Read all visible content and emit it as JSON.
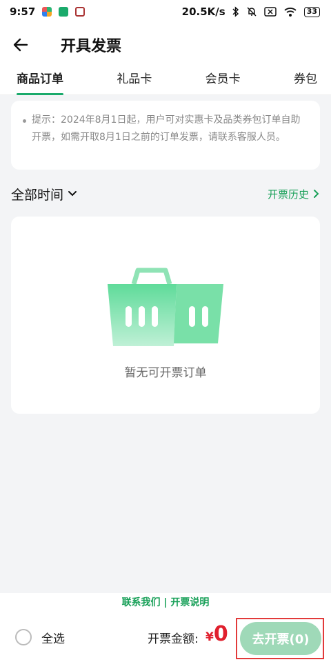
{
  "status_bar": {
    "time": "9:57",
    "network_speed": "20.5K/s",
    "battery": "33",
    "icons": [
      "app-notification-icon",
      "bluetooth-icon",
      "mute-icon",
      "sim-off-icon",
      "wifi-icon",
      "battery-icon"
    ]
  },
  "header": {
    "title": "开具发票"
  },
  "tabs": [
    {
      "label": "商品订单",
      "active": true
    },
    {
      "label": "礼品卡",
      "active": false
    },
    {
      "label": "会员卡",
      "active": false
    },
    {
      "label": "券包",
      "active": false
    }
  ],
  "notice": {
    "text": "提示：2024年8月1日起，用户可对实惠卡及品类券包订单自助开票，如需开取8月1日之前的订单发票，请联系客服人员。"
  },
  "filter": {
    "time_label": "全部时间",
    "history_label": "开票历史"
  },
  "empty_state": {
    "text": "暂无可开票订单"
  },
  "footer": {
    "links_text": "联系我们 | 开票说明"
  },
  "bottom_bar": {
    "select_all_label": "全选",
    "amount_label": "开票金额:",
    "currency": "¥",
    "amount": "0",
    "button_label": "去开票(0)"
  },
  "colors": {
    "accent": "#18a058",
    "price": "#e0202e",
    "button_disabled": "#9fd9b8"
  }
}
